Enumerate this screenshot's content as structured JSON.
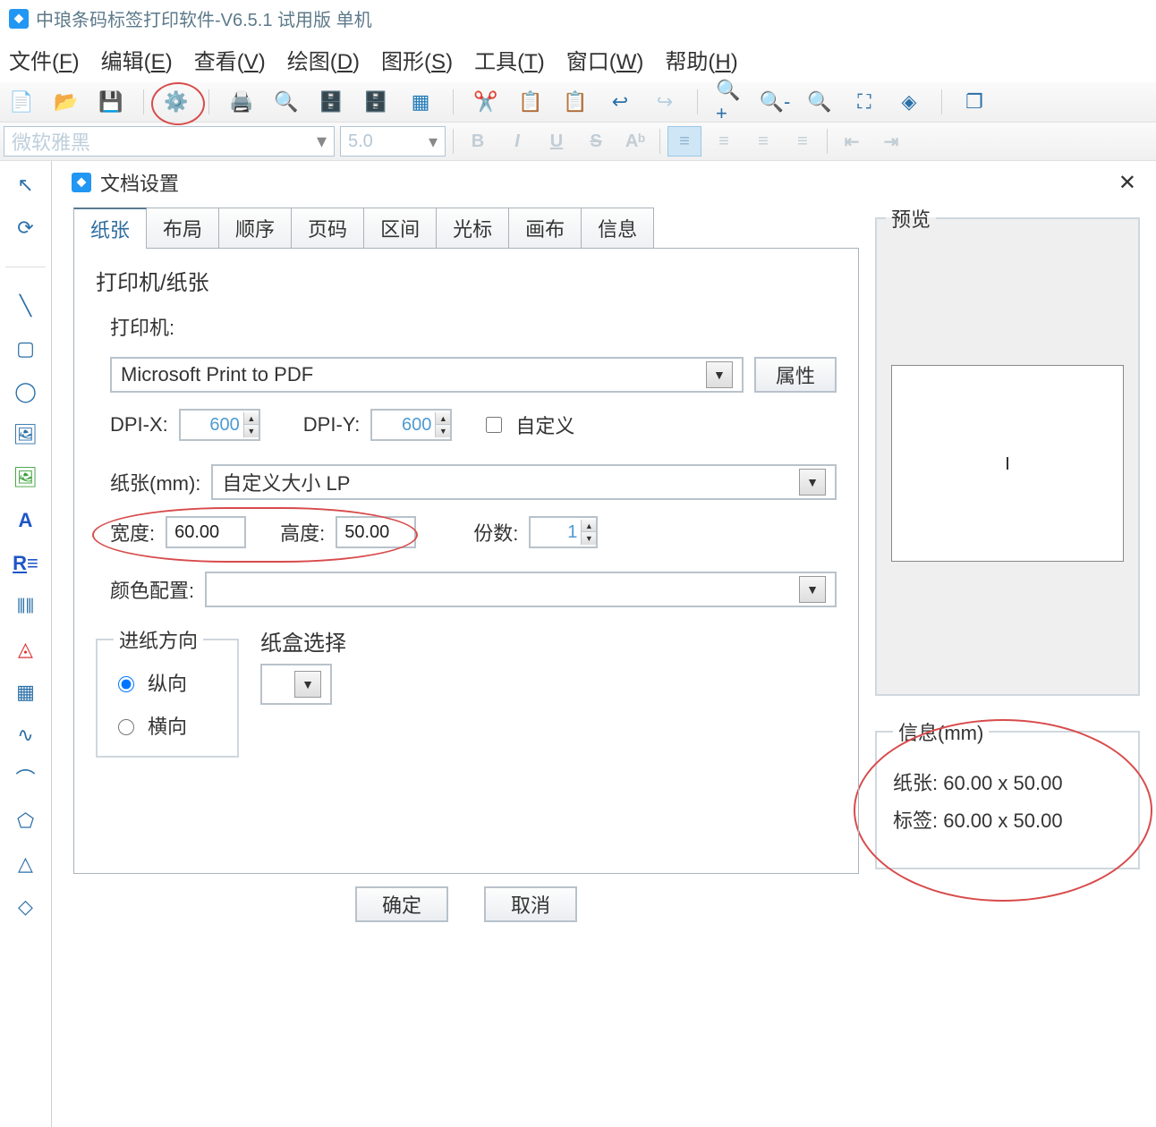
{
  "window": {
    "title": "中琅条码标签打印软件-V6.5.1 试用版 单机"
  },
  "menubar": [
    {
      "label": "文件",
      "u": "F"
    },
    {
      "label": "编辑",
      "u": "E"
    },
    {
      "label": "查看",
      "u": "V"
    },
    {
      "label": "绘图",
      "u": "D"
    },
    {
      "label": "图形",
      "u": "S"
    },
    {
      "label": "工具",
      "u": "T"
    },
    {
      "label": "窗口",
      "u": "W"
    },
    {
      "label": "帮助",
      "u": "H"
    }
  ],
  "format": {
    "font": "微软雅黑",
    "size": "5.0"
  },
  "dialog": {
    "title": "文档设置",
    "tabs": [
      "纸张",
      "布局",
      "顺序",
      "页码",
      "区间",
      "光标",
      "画布",
      "信息"
    ],
    "active_tab": "纸张",
    "group_printer_paper": "打印机/纸张",
    "printer_label": "打印机:",
    "printer_value": "Microsoft Print to PDF",
    "props_btn": "属性",
    "dpix_label": "DPI-X:",
    "dpix_value": "600",
    "dpiy_label": "DPI-Y:",
    "dpiy_value": "600",
    "custom_label": "自定义",
    "paper_label": "纸张(mm):",
    "paper_value": "自定义大小 LP",
    "width_label": "宽度:",
    "width_value": "60.00",
    "height_label": "高度:",
    "height_value": "50.00",
    "copies_label": "份数:",
    "copies_value": "1",
    "color_label": "颜色配置:",
    "color_value": "",
    "feed_group": "进纸方向",
    "feed_portrait": "纵向",
    "feed_landscape": "横向",
    "tray_group": "纸盒选择",
    "preview_title": "预览",
    "info_title": "信息(mm)",
    "info_paper": "纸张: 60.00 x 50.00",
    "info_label": "标签: 60.00 x 50.00",
    "ok": "确定",
    "cancel": "取消"
  }
}
